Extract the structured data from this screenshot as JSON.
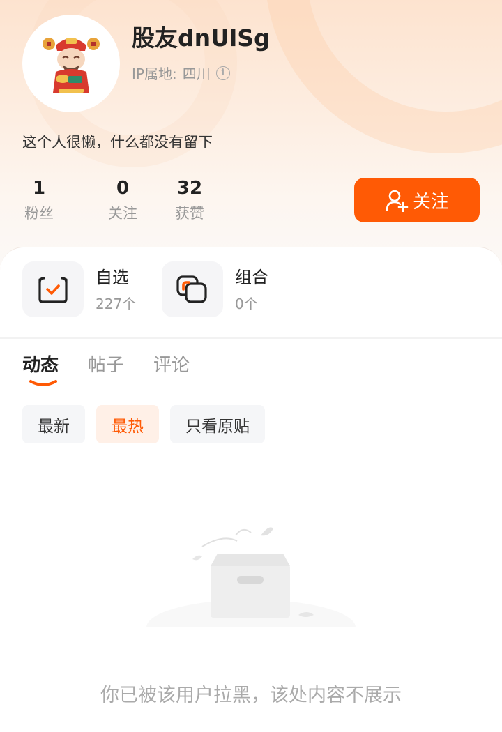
{
  "profile": {
    "username": "股友dnUlSg",
    "ip_label": "IP属地:",
    "ip_location": "四川",
    "bio": "这个人很懒，什么都没有留下"
  },
  "stats": [
    {
      "value": "1",
      "label": "粉丝"
    },
    {
      "value": "0",
      "label": "关注"
    },
    {
      "value": "32",
      "label": "获赞"
    }
  ],
  "follow_button": {
    "label": "关注"
  },
  "entries": [
    {
      "title": "自选",
      "subtitle": "227个",
      "icon": "checkbox-icon"
    },
    {
      "title": "组合",
      "subtitle": "0个",
      "icon": "portfolio-icon"
    }
  ],
  "tabs": [
    {
      "label": "动态",
      "active": true
    },
    {
      "label": "帖子",
      "active": false
    },
    {
      "label": "评论",
      "active": false
    }
  ],
  "filters": [
    {
      "label": "最新",
      "active": false
    },
    {
      "label": "最热",
      "active": true
    },
    {
      "label": "只看原贴",
      "active": false
    }
  ],
  "empty_state": {
    "message": "你已被该用户拉黑，该处内容不展示"
  },
  "colors": {
    "accent": "#ff5a05",
    "chip_active_bg": "#fff0e7"
  }
}
